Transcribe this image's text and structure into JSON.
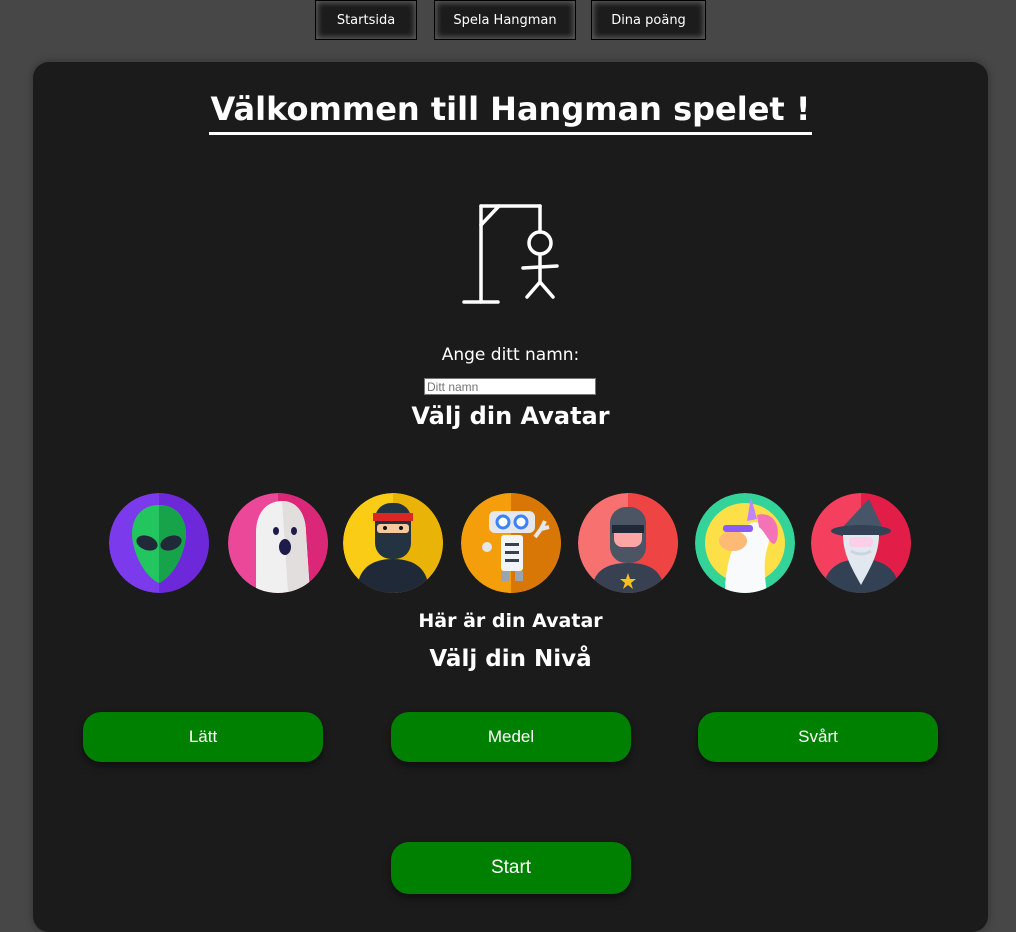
{
  "nav": {
    "items": [
      {
        "label": "Startsida"
      },
      {
        "label": "Spela Hangman"
      },
      {
        "label": "Dina poäng"
      }
    ]
  },
  "main": {
    "title": "Välkommen till Hangman spelet !",
    "name_label": "Ange ditt namn:",
    "name_placeholder": "Ditt namn",
    "avatar_heading": "Välj din Avatar",
    "avatars": [
      "alien-avatar",
      "ghost-avatar",
      "ninja-avatar",
      "robot-avatar",
      "masked-hero-avatar",
      "unicorn-avatar",
      "wizard-avatar"
    ],
    "avatar_selected_text": "Här är din Avatar",
    "level_heading": "Välj din Nivå",
    "levels": [
      {
        "label": "Lätt"
      },
      {
        "label": "Medel"
      },
      {
        "label": "Svårt"
      }
    ],
    "start_label": "Start"
  },
  "colors": {
    "background": "#474747",
    "card": "#1b1b1b",
    "button_green": "#008000",
    "text": "#ffffff"
  }
}
